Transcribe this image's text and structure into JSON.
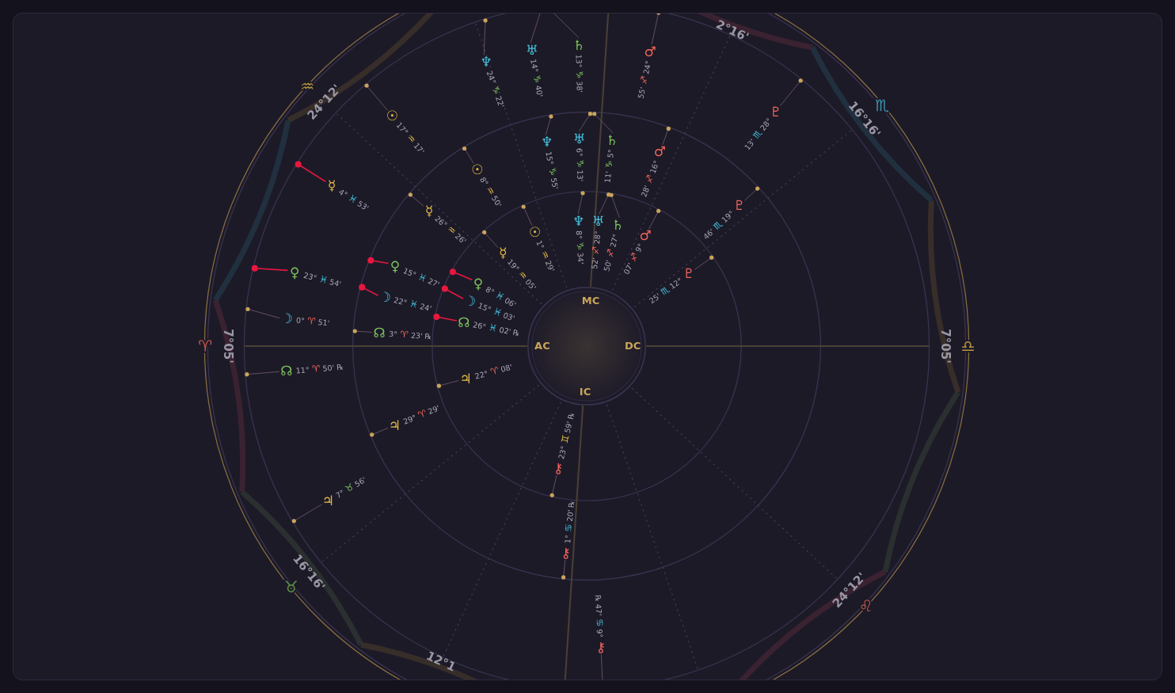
{
  "chart": {
    "hub_labels": [
      {
        "text": "MC",
        "kind": "mc"
      },
      {
        "text": "AC",
        "kind": "ac"
      },
      {
        "text": "DC",
        "kind": "dc"
      },
      {
        "text": "IC",
        "kind": "ic"
      }
    ],
    "cusps": [
      {
        "sign": "♈",
        "kind": "aries",
        "degree": "7°05'",
        "clipped": false
      },
      {
        "sign": "♉",
        "kind": "taurus",
        "degree": "16°16'",
        "clipped": false
      },
      {
        "kind": "gemini",
        "degree": "12°1",
        "clipped": true
      },
      {
        "sign": "♌",
        "kind": "leo",
        "degree": "24°12'",
        "clipped": false
      },
      {
        "sign": "♎",
        "kind": "libra",
        "degree": "7°05'",
        "clipped": false
      },
      {
        "sign": "♏",
        "kind": "scorpio",
        "degree": "16°16'",
        "clipped": false
      },
      {
        "kind": "sagittarius",
        "degree": "2°16'",
        "clipped": true
      },
      {
        "sign": "♒",
        "kind": "aquarius",
        "degree": "24°12'",
        "clipped": false
      }
    ],
    "rings": [
      {
        "planets": [
          {
            "glyph": "☉",
            "kind": "sun",
            "degree": "1°",
            "sign": {
              "symbol": "♒",
              "kind": "aquarius"
            },
            "minutes": "29'",
            "highlighted": false
          },
          {
            "glyph": "☿",
            "kind": "mercury",
            "degree": "19°",
            "sign": {
              "symbol": "♒",
              "kind": "aquarius"
            },
            "minutes": "05'",
            "highlighted": false
          },
          {
            "glyph": "♀",
            "kind": "venus",
            "degree": "8°",
            "sign": {
              "symbol": "♓",
              "kind": "pisces"
            },
            "minutes": "06'",
            "highlighted": true
          },
          {
            "glyph": "☽",
            "kind": "moon",
            "degree": "15°",
            "sign": {
              "symbol": "♓",
              "kind": "pisces"
            },
            "minutes": "03'",
            "highlighted": true
          },
          {
            "glyph": "☊",
            "kind": "node",
            "degree": "26°",
            "sign": {
              "symbol": "♓",
              "kind": "pisces"
            },
            "minutes": "02'",
            "retrograde": "℞",
            "highlighted": true
          },
          {
            "glyph": "♃",
            "kind": "jupiter",
            "degree": "22°",
            "sign": {
              "symbol": "♈",
              "kind": "aries"
            },
            "minutes": "08'",
            "highlighted": false
          },
          {
            "glyph": "⚷",
            "kind": "chiron",
            "degree": "23°",
            "sign": {
              "symbol": "♊",
              "kind": "gemini"
            },
            "minutes": "59'",
            "retrograde": "℞",
            "highlighted": false
          },
          {
            "glyph": "♆",
            "kind": "neptune",
            "degree": "8°",
            "sign": {
              "symbol": "♑",
              "kind": "capricorn"
            },
            "minutes": "34'",
            "highlighted": false
          },
          {
            "glyph": "♅",
            "kind": "uranus",
            "degree": "28°",
            "sign": {
              "symbol": "♐",
              "kind": "sagittarius"
            },
            "minutes": "52'",
            "highlighted": false
          },
          {
            "glyph": "♄",
            "kind": "saturn",
            "degree": "27°",
            "sign": {
              "symbol": "♐",
              "kind": "sagittarius"
            },
            "minutes": "50'",
            "highlighted": false
          },
          {
            "glyph": "♂",
            "kind": "mars",
            "degree": "9°",
            "sign": {
              "symbol": "♐",
              "kind": "sagittarius"
            },
            "minutes": "07'",
            "highlighted": false
          },
          {
            "glyph": "♇",
            "kind": "pluto",
            "degree": "12°",
            "sign": {
              "symbol": "♏",
              "kind": "scorpio"
            },
            "minutes": "25'",
            "highlighted": false
          }
        ]
      },
      {
        "planets": [
          {
            "glyph": "☉",
            "kind": "sun",
            "degree": "8°",
            "sign": {
              "symbol": "♒",
              "kind": "aquarius"
            },
            "minutes": "50'",
            "highlighted": false
          },
          {
            "glyph": "☿",
            "kind": "mercury",
            "degree": "26°",
            "sign": {
              "symbol": "♒",
              "kind": "aquarius"
            },
            "minutes": "26'",
            "highlighted": false
          },
          {
            "glyph": "♀",
            "kind": "venus",
            "degree": "15°",
            "sign": {
              "symbol": "♓",
              "kind": "pisces"
            },
            "minutes": "27'",
            "highlighted": true
          },
          {
            "glyph": "☽",
            "kind": "moon",
            "degree": "22°",
            "sign": {
              "symbol": "♓",
              "kind": "pisces"
            },
            "minutes": "24'",
            "highlighted": true
          },
          {
            "glyph": "☊",
            "kind": "node",
            "degree": "3°",
            "sign": {
              "symbol": "♈",
              "kind": "aries"
            },
            "minutes": "23'",
            "retrograde": "℞",
            "highlighted": false
          },
          {
            "glyph": "♃",
            "kind": "jupiter",
            "degree": "29°",
            "sign": {
              "symbol": "♈",
              "kind": "aries"
            },
            "minutes": "29'",
            "highlighted": false
          },
          {
            "glyph": "⚷",
            "kind": "chiron",
            "degree": "1°",
            "sign": {
              "symbol": "♋",
              "kind": "cancer"
            },
            "minutes": "20'",
            "retrograde": "℞",
            "highlighted": false
          },
          {
            "glyph": "♆",
            "kind": "neptune",
            "degree": "15°",
            "sign": {
              "symbol": "♑",
              "kind": "capricorn"
            },
            "minutes": "55'",
            "highlighted": false
          },
          {
            "glyph": "♅",
            "kind": "uranus",
            "degree": "6°",
            "sign": {
              "symbol": "♑",
              "kind": "capricorn"
            },
            "minutes": "13'",
            "highlighted": false
          },
          {
            "glyph": "♄",
            "kind": "saturn",
            "degree": "5°",
            "sign": {
              "symbol": "♑",
              "kind": "capricorn"
            },
            "minutes": "11'",
            "highlighted": false
          },
          {
            "glyph": "♂",
            "kind": "mars",
            "degree": "16°",
            "sign": {
              "symbol": "♐",
              "kind": "sagittarius"
            },
            "minutes": "28'",
            "highlighted": false
          },
          {
            "glyph": "♇",
            "kind": "pluto",
            "degree": "19°",
            "sign": {
              "symbol": "♏",
              "kind": "scorpio"
            },
            "minutes": "46'",
            "highlighted": false
          }
        ]
      },
      {
        "planets": [
          {
            "glyph": "☉",
            "kind": "sun",
            "degree": "17°",
            "sign": {
              "symbol": "♒",
              "kind": "aquarius"
            },
            "minutes": "17'",
            "highlighted": false
          },
          {
            "glyph": "☿",
            "kind": "mercury",
            "degree": "4°",
            "sign": {
              "symbol": "♓",
              "kind": "pisces"
            },
            "minutes": "53'",
            "highlighted": true
          },
          {
            "glyph": "♀",
            "kind": "venus",
            "degree": "23°",
            "sign": {
              "symbol": "♓",
              "kind": "pisces"
            },
            "minutes": "54'",
            "highlighted": true
          },
          {
            "glyph": "☽",
            "kind": "moon",
            "degree": "0°",
            "sign": {
              "symbol": "♈",
              "kind": "aries"
            },
            "minutes": "51'",
            "highlighted": false
          },
          {
            "glyph": "☊",
            "kind": "node",
            "degree": "11°",
            "sign": {
              "symbol": "♈",
              "kind": "aries"
            },
            "minutes": "50'",
            "retrograde": "℞",
            "highlighted": false
          },
          {
            "glyph": "♃",
            "kind": "jupiter",
            "degree": "7°",
            "sign": {
              "symbol": "♉",
              "kind": "taurus"
            },
            "minutes": "56'",
            "highlighted": false
          },
          {
            "glyph": "⚷",
            "kind": "chiron",
            "degree": "9°",
            "sign": {
              "symbol": "♋",
              "kind": "cancer"
            },
            "minutes": "47'",
            "retrograde": "℞",
            "highlighted": false
          },
          {
            "glyph": "♆",
            "kind": "neptune",
            "degree": "24°",
            "sign": {
              "symbol": "♑",
              "kind": "capricorn"
            },
            "minutes": "22'",
            "highlighted": false
          },
          {
            "glyph": "♅",
            "kind": "uranus",
            "degree": "14°",
            "sign": {
              "symbol": "♑",
              "kind": "capricorn"
            },
            "minutes": "40'",
            "highlighted": false
          },
          {
            "glyph": "♄",
            "kind": "saturn",
            "degree": "13°",
            "sign": {
              "symbol": "♑",
              "kind": "capricorn"
            },
            "minutes": "38'",
            "highlighted": false
          },
          {
            "glyph": "♂",
            "kind": "mars",
            "degree": "24°",
            "sign": {
              "symbol": "♐",
              "kind": "sagittarius"
            },
            "minutes": "55'",
            "highlighted": false
          },
          {
            "glyph": "♇",
            "kind": "pluto",
            "degree": "28°",
            "sign": {
              "symbol": "♏",
              "kind": "scorpio"
            },
            "minutes": "13'",
            "highlighted": false
          }
        ]
      }
    ]
  }
}
